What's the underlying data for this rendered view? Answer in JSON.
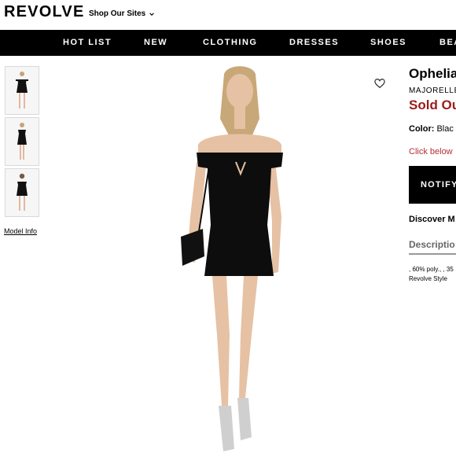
{
  "header": {
    "logo": "REVOLVE",
    "shop_sites_label": "Shop Our Sites"
  },
  "nav": {
    "items": [
      "HOT LIST",
      "NEW",
      "CLOTHING",
      "DRESSES",
      "SHOES",
      "BEA"
    ]
  },
  "gallery": {
    "model_info_label": "Model Info"
  },
  "product": {
    "title": "Ophelia",
    "brand": "MAJORELLE",
    "status": "Sold Ou",
    "color_label": "Color:",
    "color_value": "Blac",
    "click_below": "Click below",
    "notify_button": "NOTIFY",
    "discover": "Discover M",
    "description_tab": "Descriptio",
    "description_line1": ", 60% poly., , 35",
    "description_line2": "Revolve Style"
  },
  "colors": {
    "brand_red": "#9b1b1b",
    "link_red": "#b32e34",
    "nav_bg": "#000000"
  },
  "icons": [
    "chevron-down-icon",
    "heart-icon"
  ]
}
